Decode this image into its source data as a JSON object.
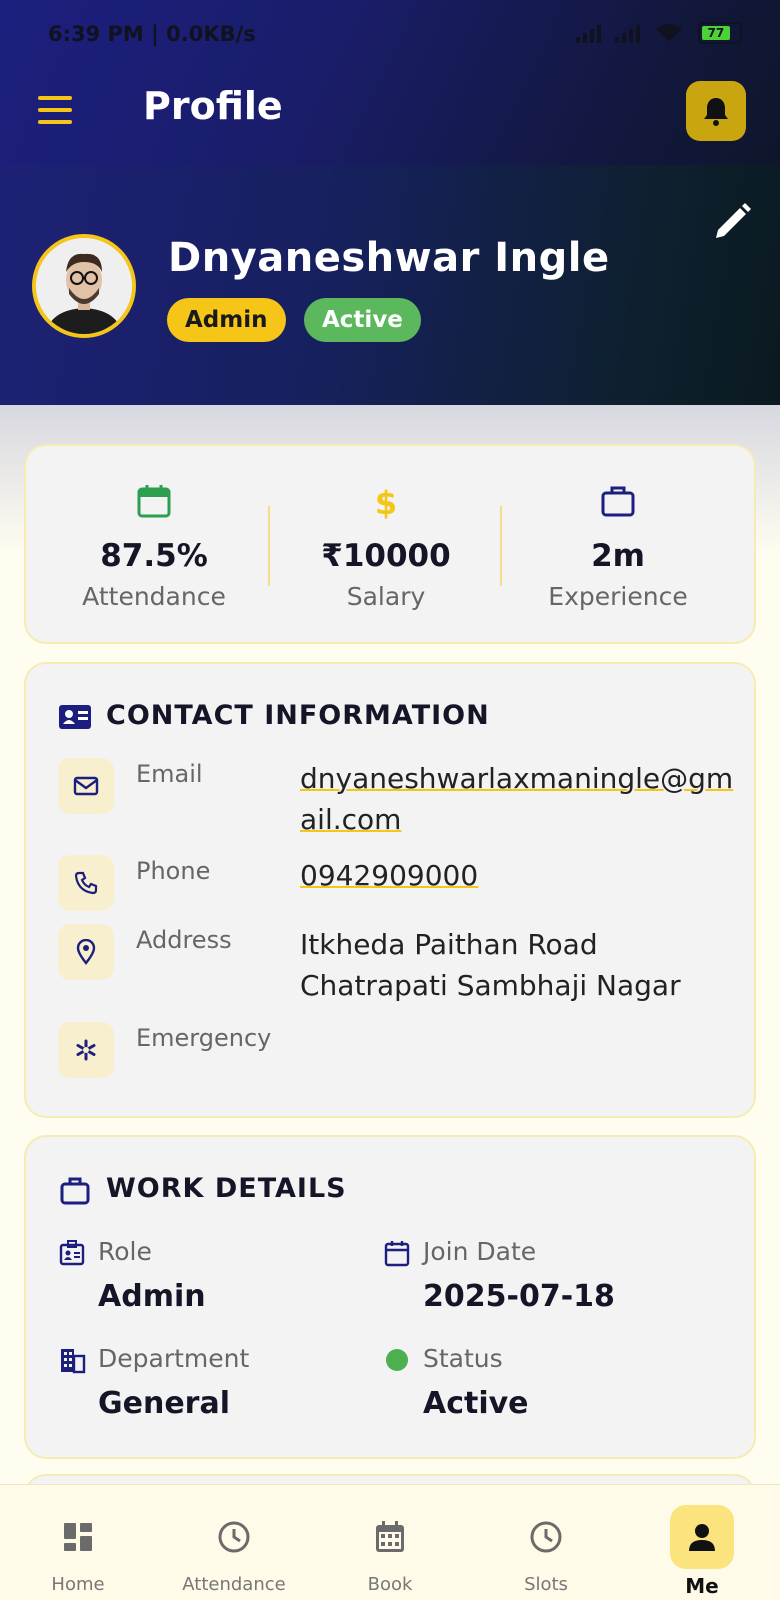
{
  "status_bar": {
    "time": "6:39 PM | 0.0KB/s",
    "battery": "77"
  },
  "app_bar": {
    "title": "Profile",
    "menu_icon": "hamburger-menu-icon",
    "notification_icon": "bell-icon",
    "accent": "#f5c518"
  },
  "profile": {
    "name": "Dnyaneshwar Ingle",
    "role_badge": "Admin",
    "status_badge": "Active"
  },
  "stats": [
    {
      "icon": "calendar-icon",
      "value": "87.5%",
      "label": "Attendance",
      "color": "#2e9e4f"
    },
    {
      "icon": "dollar-icon",
      "value": "₹10000",
      "label": "Salary",
      "color": "#f5c518"
    },
    {
      "icon": "briefcase-icon",
      "value": "2m",
      "label": "Experience",
      "color": "#1c1f7e"
    }
  ],
  "contact": {
    "title": "CONTACT INFORMATION",
    "rows": [
      {
        "icon": "mail-icon",
        "label": "Email",
        "value": "dnyaneshwarlaxmaningle@gmail.com"
      },
      {
        "icon": "phone-icon",
        "label": "Phone",
        "value": "0942909000"
      },
      {
        "icon": "location-pin-icon",
        "label": "Address",
        "value": "Itkheda Paithan Road Chatrapati Sambhaji Nagar"
      },
      {
        "icon": "emergency-icon",
        "label": "Emergency",
        "value": ""
      }
    ]
  },
  "work": {
    "title": "WORK DETAILS",
    "items": [
      {
        "icon": "id-badge-icon",
        "label": "Role",
        "value": "Admin"
      },
      {
        "icon": "calendar-icon",
        "label": "Join Date",
        "value": "2025-07-18"
      },
      {
        "icon": "building-icon",
        "label": "Department",
        "value": "General"
      },
      {
        "icon": "status-dot-icon",
        "label": "Status",
        "value": "Active"
      }
    ]
  },
  "bottom_nav": [
    {
      "icon": "dashboard-icon",
      "label": "Home"
    },
    {
      "icon": "clock-icon",
      "label": "Attendance"
    },
    {
      "icon": "calendar-grid-icon",
      "label": "Book"
    },
    {
      "icon": "clock-icon",
      "label": "Slots"
    },
    {
      "icon": "person-icon",
      "label": "Me",
      "active": true
    }
  ]
}
